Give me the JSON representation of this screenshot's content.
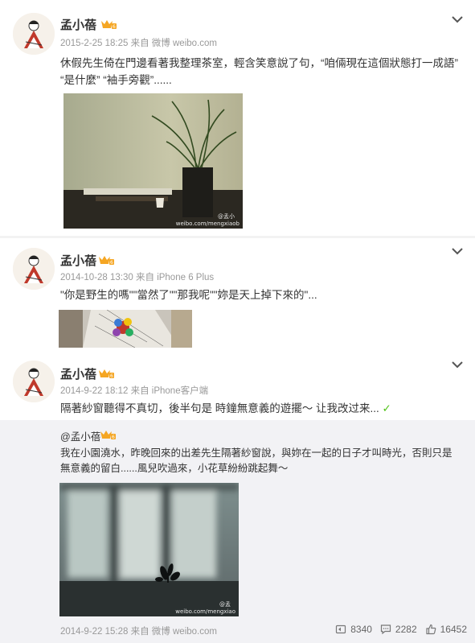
{
  "colors": {
    "vip_badge": "#f5a623",
    "meta": "#999999",
    "repost_bg": "#f2f2f5",
    "check": "#52c41a"
  },
  "posts": [
    {
      "author": "孟小蓓",
      "meta": "2015-2-25 18:25 来自 微博 weibo.com",
      "text": "休假先生倚在門邊看著我整理茶室，輕含笑意說了句，“咱倆現在這個狀態打一成語” “是什麼” “袖手旁觀”......",
      "watermark": "weibo.com/mengxiaob",
      "watermark_handle": "@孟小"
    },
    {
      "author": "孟小蓓",
      "meta": "2014-10-28 13:30 来自 iPhone 6 Plus",
      "text": "\"你是野生的嗎\"\"當然了\"\"那我呢\"\"妳是天上掉下來的\"..."
    },
    {
      "author": "孟小蓓",
      "meta": "2014-9-22 18:12 来自 iPhone客户端",
      "text": "隔著紗窗聽得不真切，後半句是 時鐘無意義的遊擺～ 让我改过来...",
      "check": "✓",
      "repost": {
        "author": "@孟小蓓",
        "text": "我在小園澆水，昨晚回來的出差先生隔著紗窗說，與妳在一起的日子才叫時光，否則只是無意義的留白......風兒吹過來，小花草紛紛跳起舞～",
        "watermark": "weibo.com/mengxiao",
        "watermark_handle": "@孟",
        "meta": "2014-9-22 15:28 来自 微博 weibo.com",
        "reposts": "8340",
        "comments": "2282",
        "likes": "16452"
      }
    }
  ]
}
